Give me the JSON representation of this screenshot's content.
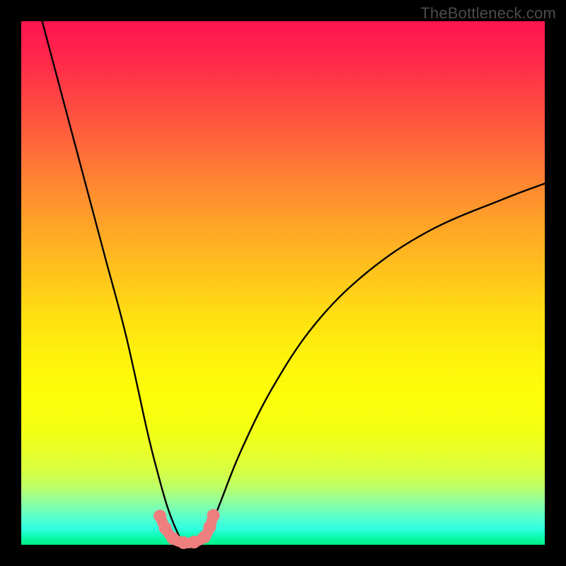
{
  "watermark": "TheBottleneck.com",
  "chart_data": {
    "type": "line",
    "title": "",
    "xlabel": "",
    "ylabel": "",
    "xlim": [
      0,
      100
    ],
    "ylim": [
      0,
      100
    ],
    "grid": false,
    "series": [
      {
        "name": "bottleneck-curve",
        "color": "#000000",
        "x": [
          4,
          8,
          12,
          16,
          20,
          24,
          26,
          28,
          30,
          31,
          32,
          33,
          34,
          36,
          38,
          42,
          48,
          56,
          66,
          78,
          92,
          100
        ],
        "y": [
          100,
          85,
          70,
          55,
          40,
          22,
          14,
          7,
          2,
          0.6,
          0.2,
          0.3,
          0.8,
          3,
          8,
          18,
          30,
          42,
          52,
          60,
          66,
          69
        ]
      },
      {
        "name": "marker-band",
        "color": "#ef7f7f",
        "x": [
          26.5,
          27.5,
          29,
          31,
          33,
          35,
          36,
          36.7
        ],
        "y": [
          5.5,
          3.2,
          1.2,
          0.4,
          0.5,
          1.5,
          3.4,
          5.6
        ]
      }
    ],
    "background_gradient": {
      "top": "#ff1450",
      "mid": "#fff20c",
      "bottom": "#00ef86"
    }
  }
}
